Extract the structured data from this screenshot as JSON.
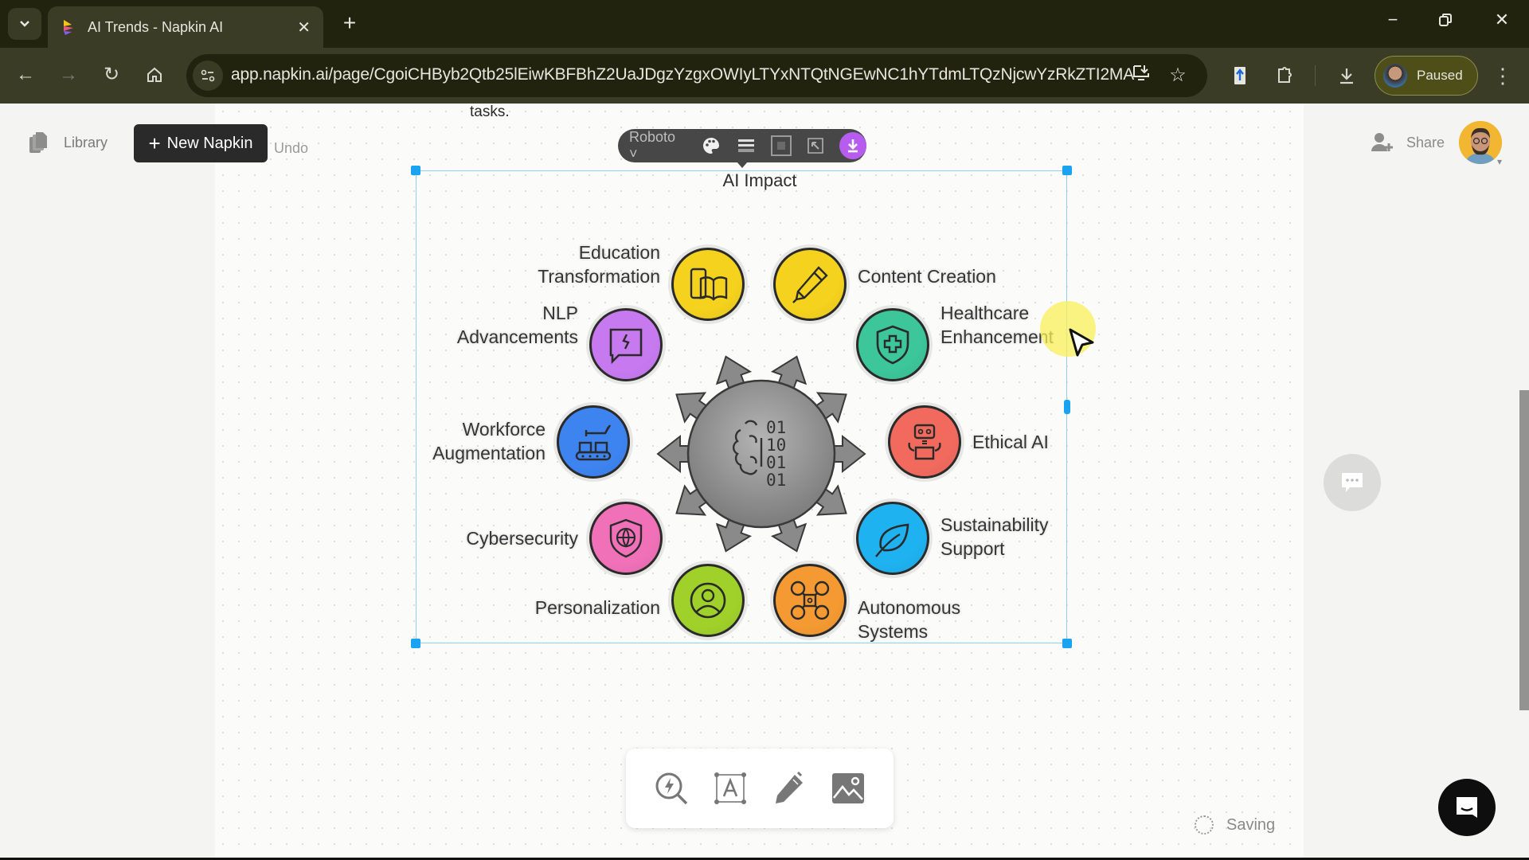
{
  "browser": {
    "tab_title": "AI Trends - Napkin AI",
    "url": "app.napkin.ai/page/CgoiCHByb2Qtb25lEiwKBFBhZ2UaJDgzYzgxOWIyLTYxNTQtNGEwNC1hYTdmLTQzNjcwYzRkZTI2MA",
    "profile_status": "Paused",
    "icons": {
      "tab_list": "chevron-down-icon",
      "back": "arrow-left-icon",
      "forward": "arrow-right-icon",
      "reload": "reload-icon",
      "home": "home-icon",
      "site_info": "tune-icon",
      "install": "install-app-icon",
      "bookmark": "star-icon",
      "extension": "extension-icon",
      "puzzle": "puzzle-icon",
      "downloads": "download-icon",
      "menu": "more-vertical-icon"
    }
  },
  "app": {
    "library_label": "Library",
    "new_napkin_label": "New Napkin",
    "undo_label": "Undo",
    "share_label": "Share",
    "preceding_text": "tasks.",
    "saving_label": "Saving"
  },
  "format_toolbar": {
    "font": "Roboto",
    "tools": [
      "palette-icon",
      "line-style-icon",
      "frame-icon",
      "resize-icon",
      "download-icon"
    ],
    "download_color": "#b65df0"
  },
  "diagram": {
    "title": "AI Impact",
    "center_icon": "brain-binary-icon",
    "center_binary": [
      "01",
      "10",
      "01",
      "01"
    ],
    "center_color": "#8e8e8e",
    "nodes": [
      {
        "id": "education",
        "lines": [
          "Education",
          "Transformation"
        ],
        "icon": "tablet-book-icon",
        "color": "#f5d21e"
      },
      {
        "id": "content",
        "lines": [
          "Content Creation"
        ],
        "icon": "pen-icon",
        "color": "#f5d21e"
      },
      {
        "id": "nlp",
        "lines": [
          "NLP",
          "Advancements"
        ],
        "icon": "chat-broken-icon",
        "color": "#c77af0"
      },
      {
        "id": "healthcare",
        "lines": [
          "Healthcare",
          "Enhancement"
        ],
        "icon": "medical-shield-icon",
        "color": "#3cc69a"
      },
      {
        "id": "workforce",
        "lines": [
          "Workforce",
          "Augmentation"
        ],
        "icon": "conveyor-robot-icon",
        "color": "#3d84f0"
      },
      {
        "id": "ethical",
        "lines": [
          "Ethical AI"
        ],
        "icon": "robot-icon",
        "color": "#f26a5e"
      },
      {
        "id": "cyber",
        "lines": [
          "Cybersecurity"
        ],
        "icon": "shield-globe-icon",
        "color": "#f071b8"
      },
      {
        "id": "sustainability",
        "lines": [
          "Sustainability",
          "Support"
        ],
        "icon": "leaf-icon",
        "color": "#1fb2f0"
      },
      {
        "id": "personalization",
        "lines": [
          "Personalization"
        ],
        "icon": "user-circle-icon",
        "color": "#9fd12a"
      },
      {
        "id": "autonomous",
        "lines": [
          "Autonomous",
          "Systems"
        ],
        "icon": "drone-icon",
        "color": "#f59a32"
      }
    ]
  },
  "dock": {
    "tools": [
      "spark-search-icon",
      "text-box-icon",
      "pen-icon",
      "image-icon"
    ]
  },
  "colors": {
    "selection": "#1aa3f0",
    "browser_bg": "#22230f",
    "toolbar_bg": "#3b3c26"
  }
}
